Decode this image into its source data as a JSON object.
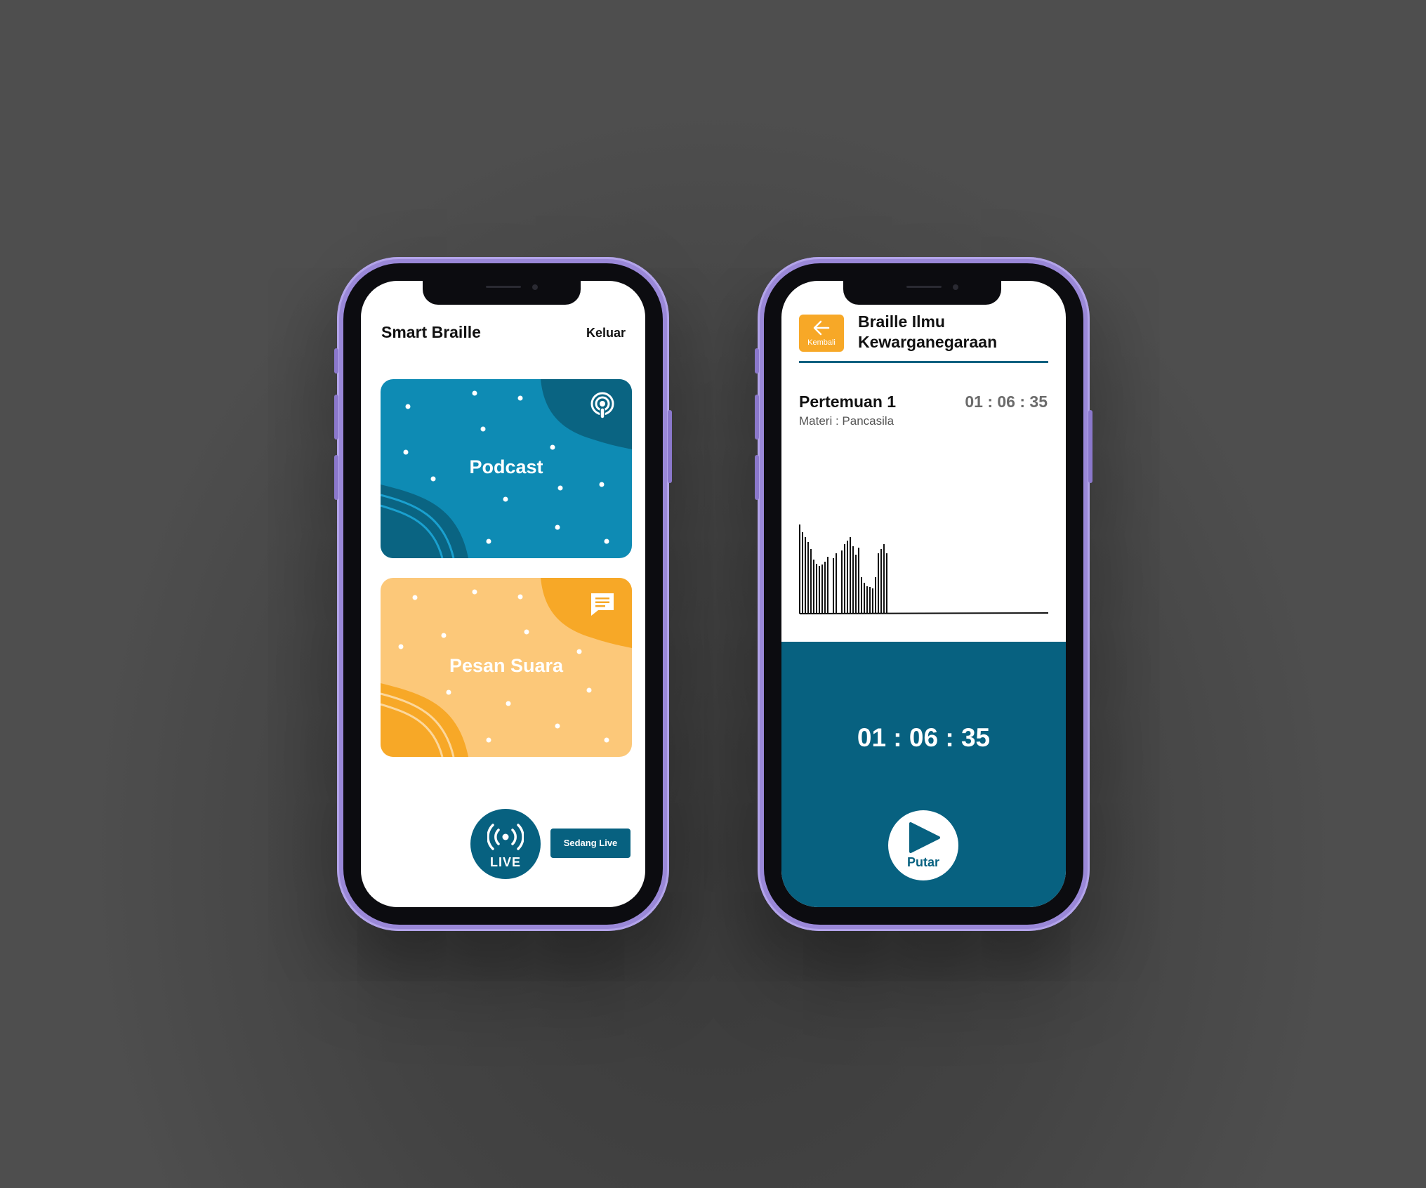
{
  "home": {
    "app_title": "Smart Braille",
    "logout_label": "Keluar",
    "cards": [
      {
        "label": "Podcast",
        "icon": "podcast-icon",
        "color": "#0e8bb4",
        "accent": "#0a6482"
      },
      {
        "label": "Pesan Suara",
        "icon": "message-icon",
        "color": "#fcc879",
        "accent": "#f7a827"
      }
    ],
    "live_button_label": "LIVE",
    "live_icon": "broadcast-icon",
    "live_status_label": "Sedang Live"
  },
  "player": {
    "back_label": "Kembali",
    "back_icon": "arrow-left-icon",
    "course_title": "Braille Ilmu Kewarganegaraan",
    "session_title": "Pertemuan 1",
    "session_duration": "01 : 06 : 35",
    "session_subject": "Materi : Pancasila",
    "current_time": "01 : 06 : 35",
    "play_label": "Putar",
    "play_icon": "play-icon",
    "colors": {
      "primary": "#076180",
      "accent": "#f7a827"
    }
  }
}
